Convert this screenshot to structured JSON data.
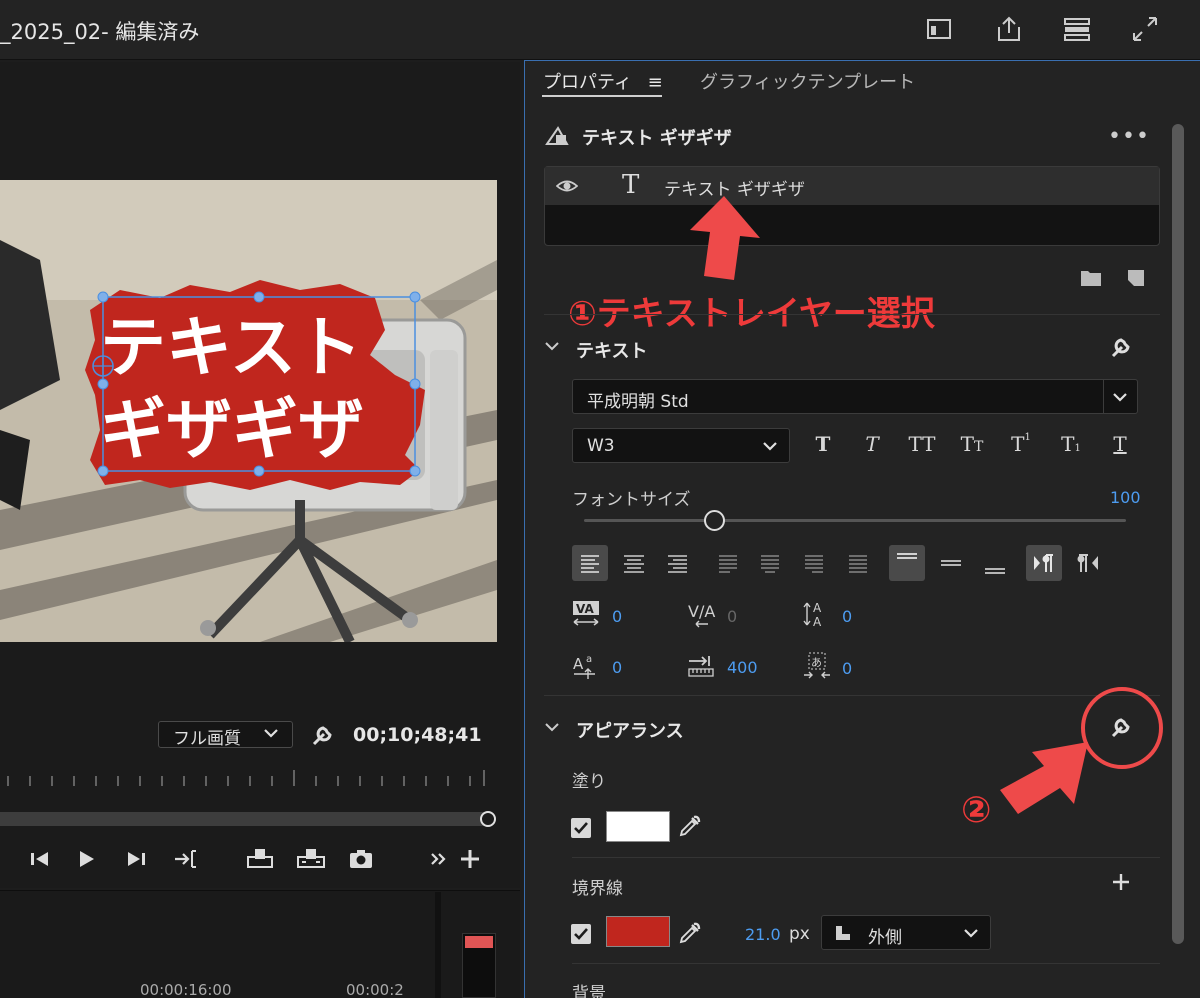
{
  "window": {
    "title": "_2025_02- 編集済み",
    "icons": [
      "workspace-icon",
      "export-icon",
      "panels-icon",
      "expand-icon"
    ]
  },
  "monitor": {
    "overlay_text_line1": "テキスト",
    "overlay_text_line2": "ギザギザ",
    "quality": "フル画質",
    "timecode": "00;10;48;41",
    "timeline_labels": [
      "00:00:16:00",
      "00:00:2"
    ]
  },
  "properties": {
    "tabs": {
      "properties": "プロパティ",
      "graphics_template": "グラフィックテンプレート"
    },
    "clip_title": "テキスト ギザギザ",
    "layer_name": "テキスト ギザギザ",
    "text_section": {
      "title": "テキスト",
      "font_family": "平成明朝 Std",
      "font_style": "W3",
      "font_size_label": "フォントサイズ",
      "font_size_value": "100",
      "font_size_fraction": 0.24,
      "tracking_kerning": "0",
      "kerning": "0",
      "leading": "0",
      "baseline_shift": "0",
      "tab_width": "400",
      "tsume": "0"
    },
    "appearance": {
      "title": "アピアランス",
      "fill_label": "塗り",
      "fill_color": "#ffffff",
      "stroke_label": "境界線",
      "stroke_color": "#c0261e",
      "stroke_width": "21.0",
      "stroke_unit": "px",
      "stroke_position": "外側",
      "background_label": "背景"
    }
  },
  "annotations": {
    "step1": "①テキストレイヤー選択",
    "step2": "②",
    "color": "#ee3a3a"
  }
}
